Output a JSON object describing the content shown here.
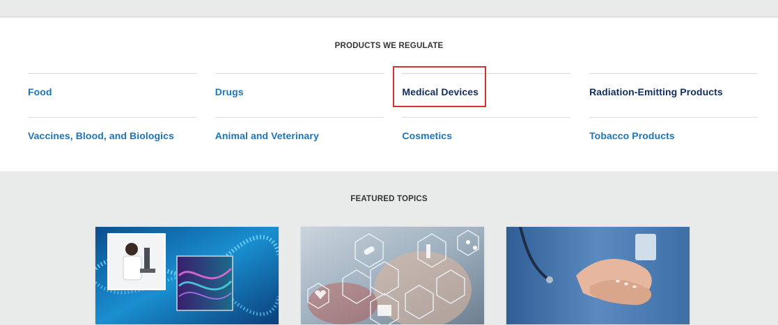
{
  "products": {
    "title": "PRODUCTS WE REGULATE",
    "items": [
      {
        "label": "Food",
        "dark": false
      },
      {
        "label": "Drugs",
        "dark": false
      },
      {
        "label": "Medical Devices",
        "dark": true
      },
      {
        "label": "Radiation-Emitting Products",
        "dark": true
      },
      {
        "label": "Vaccines, Blood, and Biologics",
        "dark": false
      },
      {
        "label": "Animal and Veterinary",
        "dark": false
      },
      {
        "label": "Cosmetics",
        "dark": false
      },
      {
        "label": "Tobacco Products",
        "dark": false
      }
    ]
  },
  "featured": {
    "title": "FEATURED TOPICS",
    "cards": [
      {
        "image": "dna-research-image"
      },
      {
        "image": "medical-icons-image"
      },
      {
        "image": "nurse-hands-image"
      }
    ]
  },
  "colors": {
    "link": "#1b75bb",
    "link_dark": "#0f2d5e",
    "highlight": "#d9302c"
  }
}
